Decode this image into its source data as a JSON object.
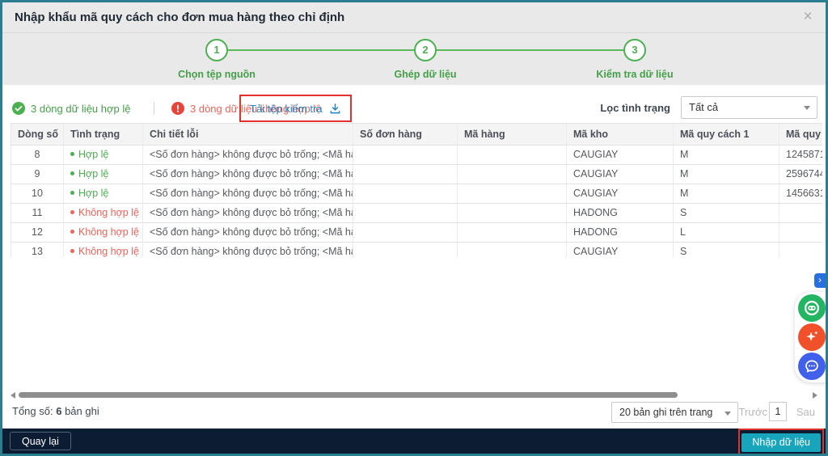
{
  "dialog": {
    "title": "Nhập khẩu mã quy cách cho đơn mua hàng theo chỉ định",
    "close_icon": "×"
  },
  "stepper": {
    "steps": [
      {
        "number": "1",
        "label": "Chọn tệp nguồn"
      },
      {
        "number": "2",
        "label": "Ghép dữ liệu"
      },
      {
        "number": "3",
        "label": "Kiểm tra dữ liệu"
      }
    ]
  },
  "toolbar": {
    "valid_count_text": "3 dòng dữ liệu hợp lệ",
    "invalid_count_text": "3 dòng dữ liệu không hợp lệ",
    "download_check_file_label": "Tải tệp kiểm tra",
    "filter_label": "Lọc tình trạng",
    "filter_selected": "Tất cả"
  },
  "table": {
    "columns": [
      "Dòng số",
      "Tình trạng",
      "Chi tiết lỗi",
      "Số đơn hàng",
      "Mã hàng",
      "Mã kho",
      "Mã quy cách 1",
      "Mã quy cách"
    ],
    "rows": [
      {
        "line_no": "8",
        "status": "Hợp lệ",
        "valid": true,
        "error_detail": "<Số đơn hàng> không được bỏ trống; <Mã hàng> kh...",
        "order_no": "",
        "item_code": "",
        "warehouse_code": "CAUGIAY",
        "spec_code_1": "M",
        "spec_code_2": "1245871"
      },
      {
        "line_no": "9",
        "status": "Hợp lệ",
        "valid": true,
        "error_detail": "<Số đơn hàng> không được bỏ trống; <Mã hàng> kh...",
        "order_no": "",
        "item_code": "",
        "warehouse_code": "CAUGIAY",
        "spec_code_1": "M",
        "spec_code_2": "2596744"
      },
      {
        "line_no": "10",
        "status": "Hợp lệ",
        "valid": true,
        "error_detail": "<Số đơn hàng> không được bỏ trống; <Mã hàng> kh...",
        "order_no": "",
        "item_code": "",
        "warehouse_code": "CAUGIAY",
        "spec_code_1": "M",
        "spec_code_2": "1456631"
      },
      {
        "line_no": "11",
        "status": "Không hợp lệ",
        "valid": false,
        "error_detail": "<Số đơn hàng> không được bỏ trống; <Mã hàng> kh...",
        "order_no": "",
        "item_code": "",
        "warehouse_code": "HADONG",
        "spec_code_1": "S",
        "spec_code_2": ""
      },
      {
        "line_no": "12",
        "status": "Không hợp lệ",
        "valid": false,
        "error_detail": "<Số đơn hàng> không được bỏ trống; <Mã hàng> kh...",
        "order_no": "",
        "item_code": "",
        "warehouse_code": "HADONG",
        "spec_code_1": "L",
        "spec_code_2": ""
      },
      {
        "line_no": "13",
        "status": "Không hợp lệ",
        "valid": false,
        "error_detail": "<Số đơn hàng> không được bỏ trống; <Mã hàng> kh...",
        "order_no": "",
        "item_code": "",
        "warehouse_code": "CAUGIAY",
        "spec_code_1": "S",
        "spec_code_2": ""
      }
    ]
  },
  "pagination": {
    "total_label": "Tổng số:",
    "total_value": "6",
    "total_unit": "bản ghi",
    "page_size_selected": "20 bản ghi trên trang",
    "prev_label": "Trước",
    "current_page": "1",
    "next_label": "Sau"
  },
  "footer_actions": {
    "back_label": "Quay lại",
    "import_label": "Nhập dữ liệu"
  },
  "floating_widgets": {
    "expand_tab_icon": "›",
    "buttons": [
      {
        "name": "chat-widget-button",
        "icon": "chat-eyes-icon",
        "color": "#23b561"
      },
      {
        "name": "ai-assistant-button",
        "icon": "sparkle-icon",
        "color": "#f0502a"
      },
      {
        "name": "feedback-chat-button",
        "icon": "chat-dots-icon",
        "color": "#4161ea"
      }
    ]
  },
  "colors": {
    "dialog_border": "#2b7e90",
    "accent_teal": "#18a4ba",
    "success_green": "#4caf50",
    "error_red": "#f0625a",
    "link_blue": "#2085c7",
    "navy_footer": "#0c1d33",
    "highlight_red": "#e0312e"
  }
}
